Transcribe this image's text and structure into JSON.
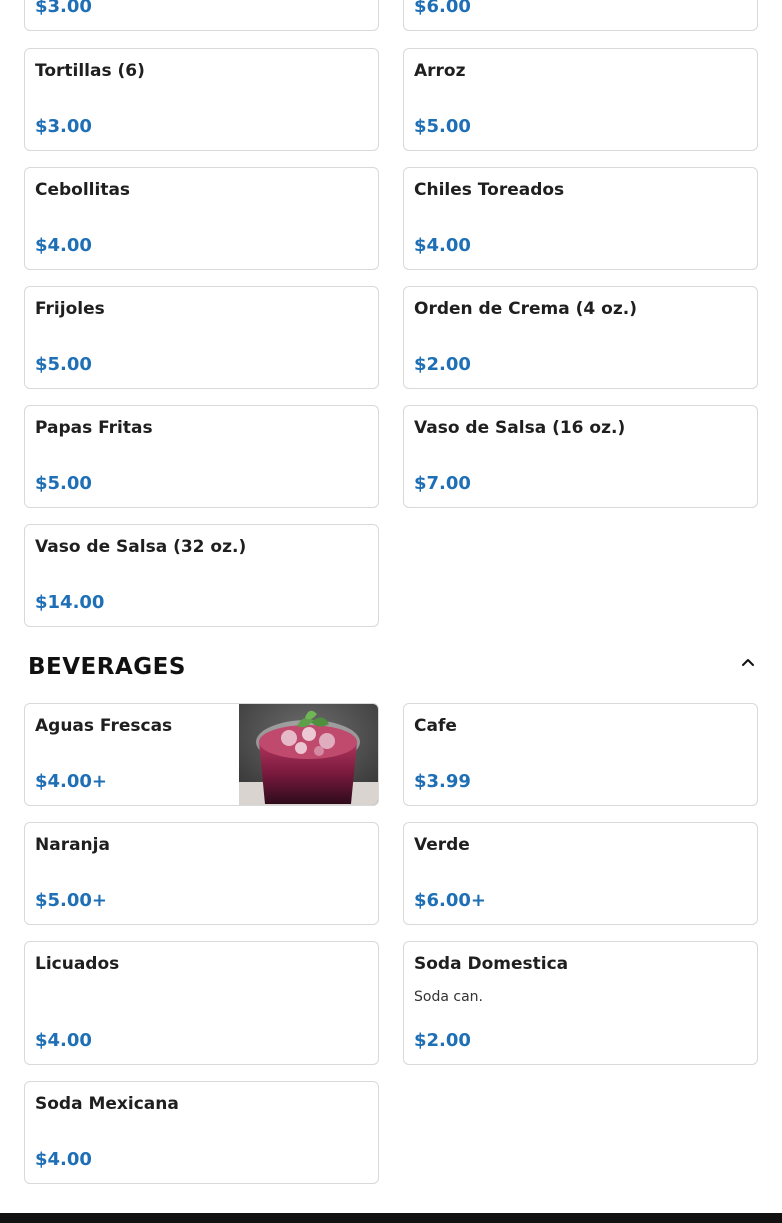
{
  "sides_section": {
    "items": [
      {
        "name": "",
        "price": "$3.00"
      },
      {
        "name": "",
        "price": "$6.00"
      },
      {
        "name": "Tortillas (6)",
        "price": "$3.00"
      },
      {
        "name": "Arroz",
        "price": "$5.00"
      },
      {
        "name": "Cebollitas",
        "price": "$4.00"
      },
      {
        "name": "Chiles Toreados",
        "price": "$4.00"
      },
      {
        "name": "Frijoles",
        "price": "$5.00"
      },
      {
        "name": "Orden de Crema (4 oz.)",
        "price": "$2.00"
      },
      {
        "name": "Papas Fritas",
        "price": "$5.00"
      },
      {
        "name": "Vaso de Salsa (16 oz.)",
        "price": "$7.00"
      },
      {
        "name": "Vaso de Salsa (32 oz.)",
        "price": "$14.00"
      }
    ]
  },
  "beverages_section": {
    "title": "BEVERAGES",
    "collapse_icon": "chevron-up-icon",
    "items": [
      {
        "name": "Aguas Frescas",
        "price": "$4.00+",
        "has_image": true
      },
      {
        "name": "Cafe",
        "price": "$3.99"
      },
      {
        "name": "Naranja",
        "price": "$5.00+"
      },
      {
        "name": "Verde",
        "price": "$6.00+"
      },
      {
        "name": "Licuados",
        "price": "$4.00"
      },
      {
        "name": "Soda Domestica",
        "description": "Soda can.",
        "price": "$2.00"
      },
      {
        "name": "Soda Mexicana",
        "price": "$4.00"
      }
    ]
  },
  "colors": {
    "price": "#1e6fb5",
    "border": "#d9d9d9",
    "footer": "#111111"
  }
}
